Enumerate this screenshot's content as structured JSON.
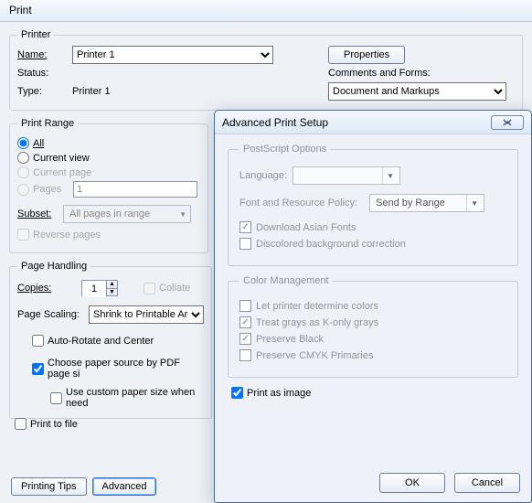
{
  "window": {
    "title": "Print"
  },
  "printer_section": {
    "legend": "Printer",
    "name_label": "Name:",
    "status_label": "Status:",
    "type_label": "Type:",
    "printer_options": [
      "Printer 1"
    ],
    "printer_selected": "Printer 1",
    "status_value": "",
    "type_value": "Printer 1",
    "properties_btn": "Properties",
    "comments_label": "Comments and Forms:",
    "comments_selected": "Document and Markups"
  },
  "range": {
    "legend": "Print Range",
    "all": "All",
    "current_view": "Current view",
    "current_page": "Current page",
    "pages": "Pages",
    "pages_value": "1",
    "subset_label": "Subset:",
    "subset_value": "All pages in range",
    "reverse": "Reverse pages"
  },
  "handling": {
    "legend": "Page Handling",
    "copies_label": "Copies:",
    "copies_value": "1",
    "collate": "Collate",
    "scaling_label": "Page Scaling:",
    "scaling_value": "Shrink to Printable Area",
    "auto_rotate": "Auto-Rotate and Center",
    "choose_source": "Choose paper source by PDF page si",
    "custom_paper": "Use custom paper size when need"
  },
  "print_to_file": "Print to file",
  "bottom": {
    "tips": "Printing Tips",
    "advanced": "Advanced"
  },
  "overlay": {
    "title": "Advanced Print Setup",
    "ps": {
      "legend": "PostScript Options",
      "language": "Language:",
      "policy": "Font and Resource Policy:",
      "policy_value": "Send by Range",
      "download_asian": "Download Asian Fonts",
      "discolored": "Discolored background correction"
    },
    "color": {
      "legend": "Color Management",
      "let_printer": "Let printer determine colors",
      "treat_grays": "Treat grays as K-only grays",
      "preserve_black": "Preserve Black",
      "preserve_cmyk": "Preserve CMYK Primaries"
    },
    "print_as_image": "Print as image",
    "ok": "OK",
    "cancel": "Cancel"
  }
}
